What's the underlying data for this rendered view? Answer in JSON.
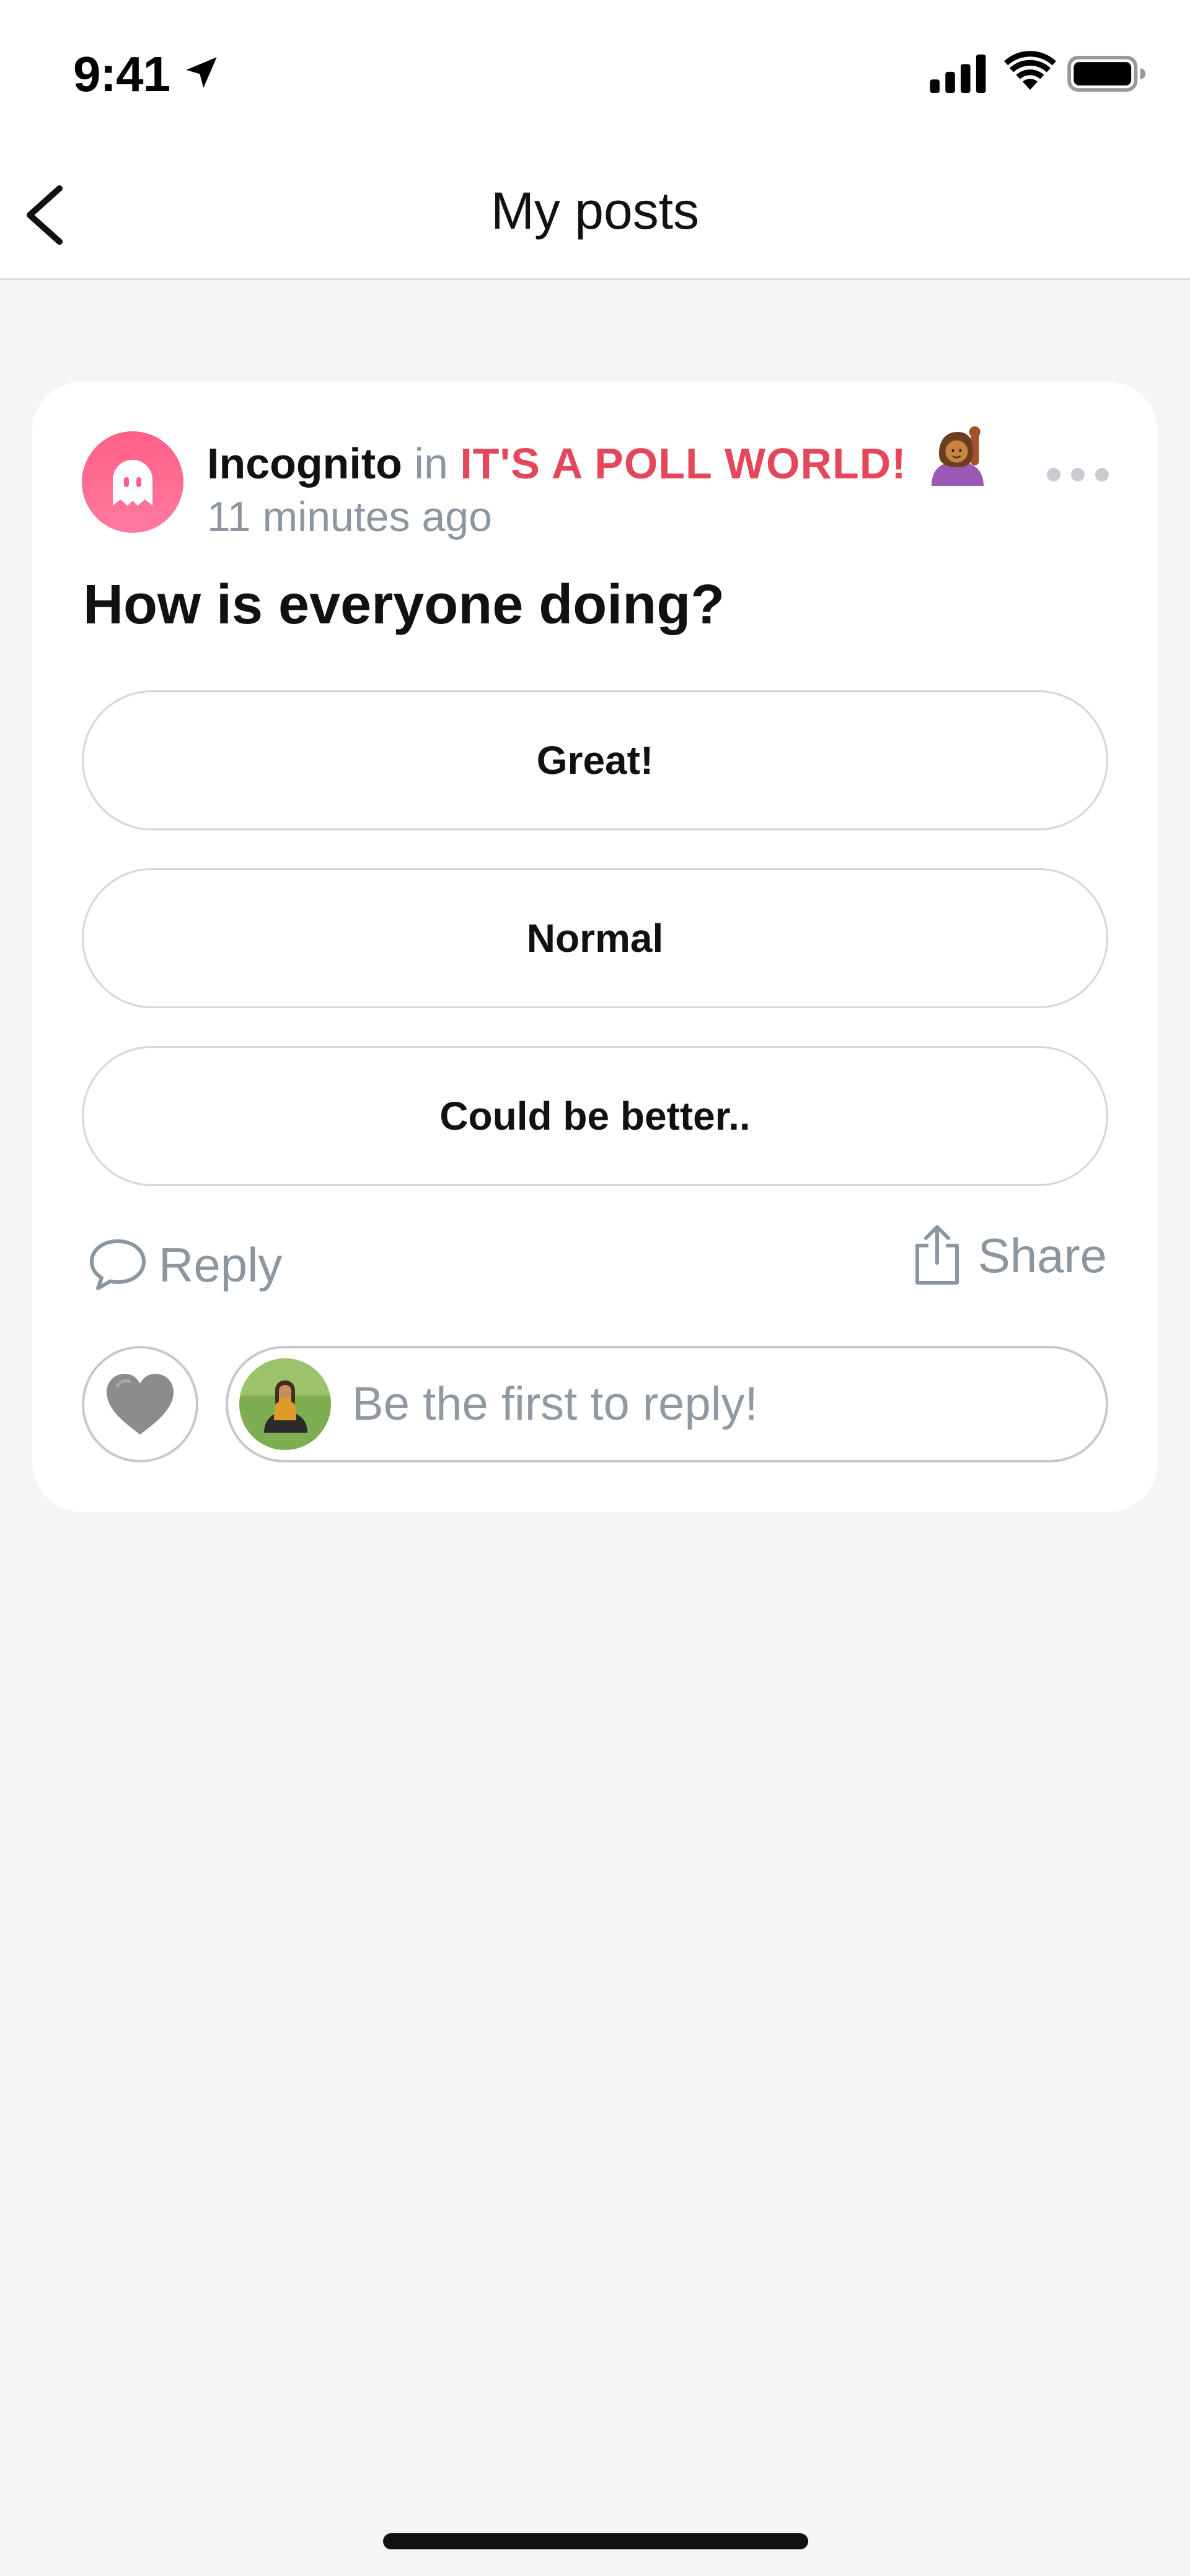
{
  "status_bar": {
    "time": "9:41",
    "location_icon": "location-arrow-icon",
    "signal_icon": "cellular-signal-icon",
    "wifi_icon": "wifi-icon",
    "battery_icon": "battery-icon"
  },
  "header": {
    "back_icon": "chevron-left-icon",
    "title": "My posts"
  },
  "post": {
    "avatar_icon": "ghost-icon",
    "author": "Incognito",
    "in_word": "in",
    "community": "IT'S A POLL WORLD!",
    "community_emoji": "person-raising-hand-emoji",
    "timestamp": "11 minutes ago",
    "more_icon": "more-horizontal-icon",
    "question": "How is everyone doing?",
    "poll_options": [
      "Great!",
      "Normal",
      "Could be better.."
    ],
    "actions": {
      "reply_label": "Reply",
      "reply_icon": "speech-bubble-icon",
      "share_label": "Share",
      "share_icon": "share-icon"
    },
    "like_icon": "grey-heart-icon",
    "reply_input": {
      "placeholder": "Be the first to reply!",
      "value": ""
    }
  },
  "colors": {
    "accent": "#e5475a",
    "avatar_pink": "#ff5f86",
    "muted_text": "#8c96a0",
    "background": "#f5f5f7"
  }
}
